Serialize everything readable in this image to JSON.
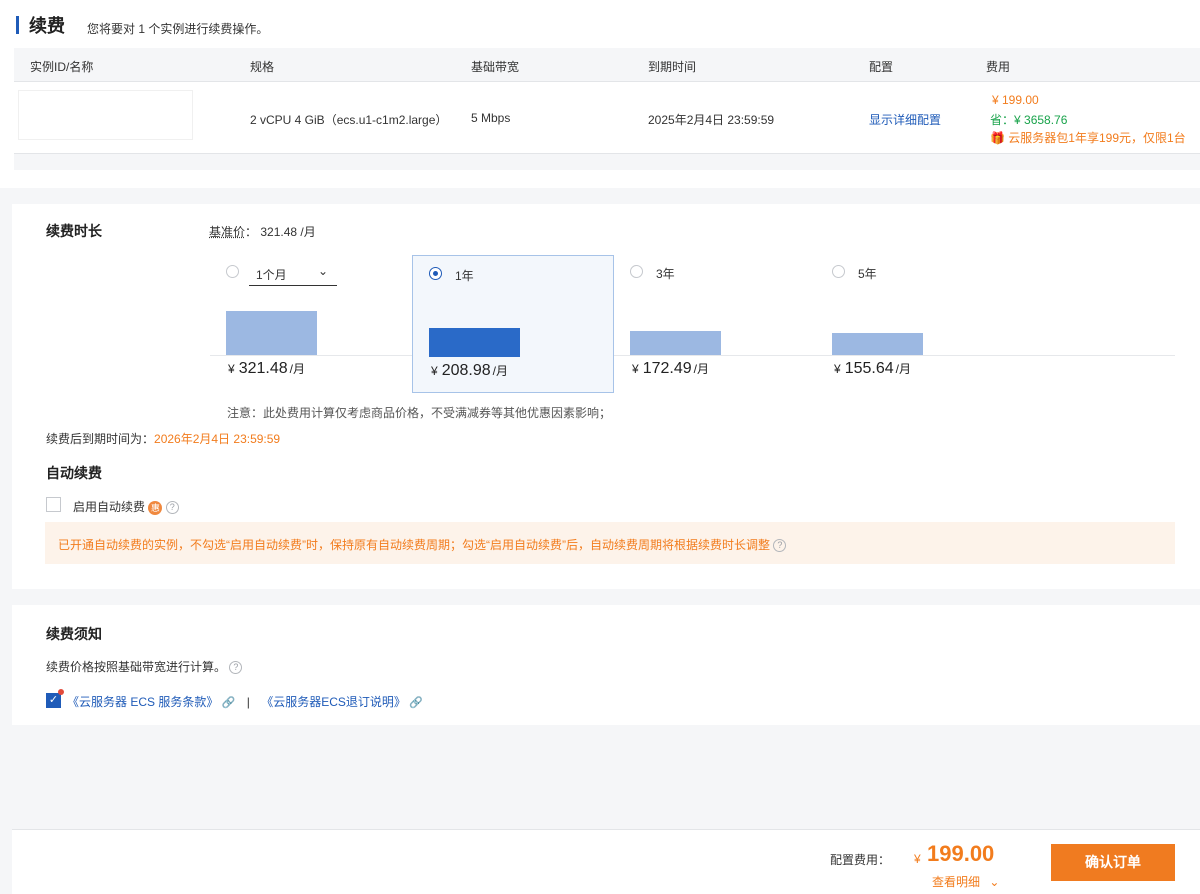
{
  "header": {
    "title": "续费",
    "subtitle": "您将要对 1 个实例进行续费操作。"
  },
  "table": {
    "columns": [
      "实例ID/名称",
      "规格",
      "基础带宽",
      "到期时间",
      "配置",
      "费用"
    ],
    "row": {
      "spec": "2 vCPU 4 GiB（ecs.u1-c1m2.large）",
      "bandwidth": "5 Mbps",
      "expire": "2025年2月4日 23:59:59",
      "config_link": "显示详细配置",
      "fee": "¥ 199.00",
      "save_label": "省：",
      "save_amount": "¥ 3658.76",
      "promo_icon": "gift-icon",
      "promo": "云服务器包1年享199元，仅限1台"
    }
  },
  "renew": {
    "title": "续费时长",
    "base_price_label": "基准价",
    "base_price_value": "：  321.48 /月",
    "options": [
      {
        "label": "1个月",
        "type": "dropdown",
        "price": "321.48",
        "selected": false,
        "bar_fraction": 0.49
      },
      {
        "label": "1年",
        "type": "radio",
        "price": "208.98",
        "selected": true,
        "bar_fraction": 0.32
      },
      {
        "label": "3年",
        "type": "radio",
        "price": "172.49",
        "selected": false,
        "bar_fraction": 0.27
      },
      {
        "label": "5年",
        "type": "radio",
        "price": "155.64",
        "selected": false,
        "bar_fraction": 0.24
      }
    ],
    "currency": "¥",
    "per_month": "/月",
    "note": "注意：此处费用计算仅考虑商品价格，不受满减券等其他优惠因素影响；",
    "expire_label": "续费后到期时间为：",
    "expire_value": "2026年2月4日 23:59:59"
  },
  "auto_renew": {
    "title": "自动续费",
    "checkbox_label": "启用自动续费",
    "badge": "惠",
    "tip": "已开通自动续费的实例，不勾选“启用自动续费”时，保持原有自动续费周期；勾选“启用自动续费”后，自动续费周期将根据续费时长调整"
  },
  "notice": {
    "title": "续费须知",
    "text": "续费价格按照基础带宽进行计算。",
    "link1": "《云服务器 ECS 服务条款》",
    "separator": "|",
    "link2": "《云服务器ECS退订说明》"
  },
  "footer": {
    "fee_label": "配置费用：",
    "currency": "¥",
    "amount": "199.00",
    "detail_link": "查看明细",
    "confirm_button": "确认订单"
  },
  "colors": {
    "accent": "#1f5bb8",
    "orange": "#f27c1d",
    "green": "#19a34b",
    "bar": "#9cb8e2",
    "bar_selected": "#2a6ac8"
  }
}
